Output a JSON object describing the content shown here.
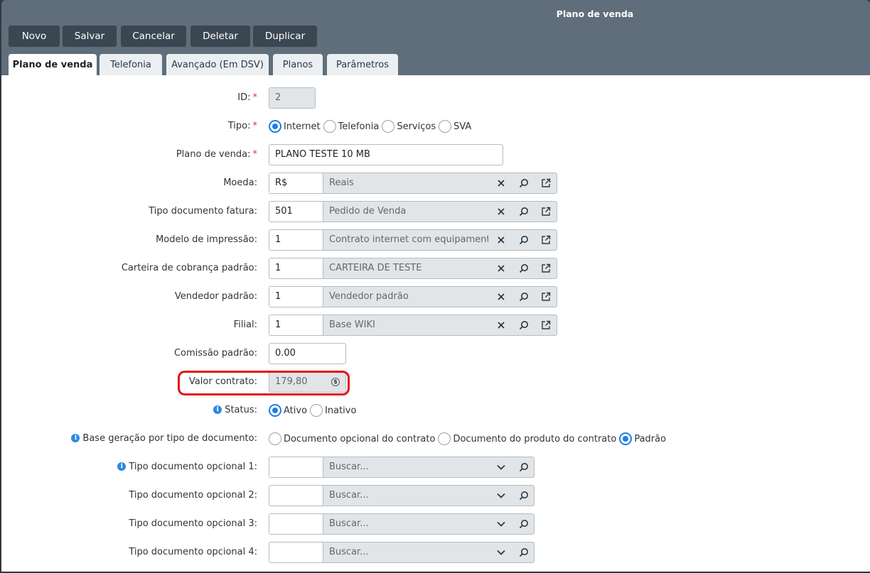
{
  "window": {
    "title": "Plano de venda"
  },
  "toolbar": [
    "Novo",
    "Salvar",
    "Cancelar",
    "Deletar",
    "Duplicar"
  ],
  "tabs": [
    "Plano de venda",
    "Telefonia",
    "Avançado (Em DSV)",
    "Planos",
    "Parâmetros"
  ],
  "form": {
    "id": {
      "label": "ID:",
      "value": "2"
    },
    "tipo": {
      "label": "Tipo:",
      "options": [
        "Internet",
        "Telefonia",
        "Serviços",
        "SVA"
      ],
      "selected": "Internet"
    },
    "plano": {
      "label": "Plano de venda:",
      "value": "PLANO TESTE 10 MB"
    },
    "lookups": [
      {
        "label": "Moeda:",
        "code": "R$",
        "desc": "Reais"
      },
      {
        "label": "Tipo documento fatura:",
        "code": "501",
        "desc": "Pedido de Venda"
      },
      {
        "label": "Modelo de impressão:",
        "code": "1",
        "desc": "Contrato internet com equipament..."
      },
      {
        "label": "Carteira de cobrança padrão:",
        "code": "1",
        "desc": "CARTEIRA DE TESTE"
      },
      {
        "label": "Vendedor padrão:",
        "code": "1",
        "desc": "Vendedor padrão"
      },
      {
        "label": "Filial:",
        "code": "1",
        "desc": "Base WIKI"
      }
    ],
    "comissao": {
      "label": "Comissão padrão:",
      "value": "0.00"
    },
    "valor": {
      "label": "Valor contrato:",
      "value": "179,80"
    },
    "status": {
      "label": "Status:",
      "options": [
        "Ativo",
        "Inativo"
      ],
      "selected": "Ativo"
    },
    "base": {
      "label": "Base geração por tipo de documento:",
      "options": [
        "Documento opcional do contrato",
        "Documento do produto do contrato",
        "Padrão"
      ],
      "selected": "Padrão"
    },
    "opcionais": [
      {
        "label": "Tipo documento opcional 1:",
        "placeholder": "Buscar...",
        "info": true
      },
      {
        "label": "Tipo documento opcional 2:",
        "placeholder": "Buscar...",
        "info": false
      },
      {
        "label": "Tipo documento opcional 3:",
        "placeholder": "Buscar...",
        "info": false
      },
      {
        "label": "Tipo documento opcional 4:",
        "placeholder": "Buscar...",
        "info": false
      }
    ]
  },
  "colors": {
    "accent": "#1e7ee0",
    "highlight": "#e0131b",
    "header": "#5f6e7a",
    "button": "#3a4650"
  }
}
